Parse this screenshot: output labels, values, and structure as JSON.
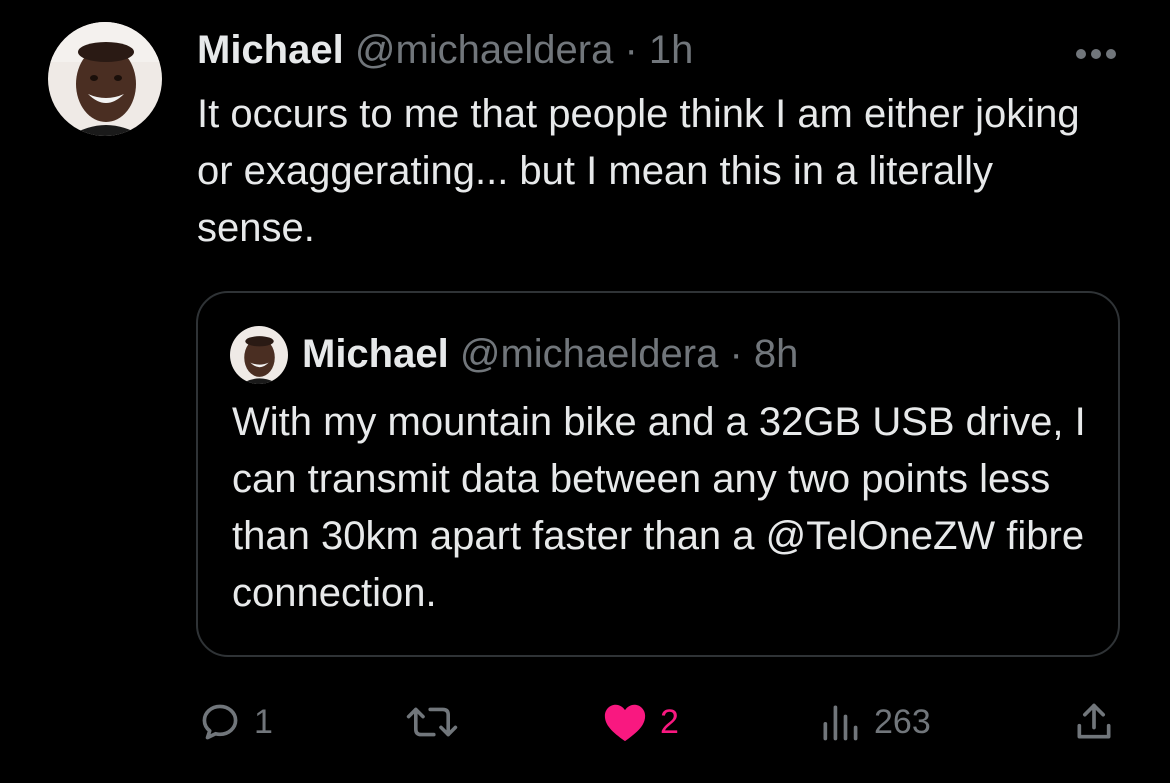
{
  "tweet": {
    "name": "Michael",
    "handle": "@michaeldera",
    "separator": "·",
    "time": "1h",
    "more_icon": "more-horizontal-icon",
    "text": "It occurs to me that people think I am either joking or exaggerating... but I mean this in a literally sense."
  },
  "quoted": {
    "name": "Michael",
    "handle": "@michaeldera",
    "separator": "·",
    "time": "8h",
    "text": "With my mountain bike and a 32GB USB drive, I can transmit data between any two points less than 30km apart faster than a @TelOneZW fibre connection."
  },
  "actions": {
    "reply": {
      "icon": "reply-icon",
      "count": "1"
    },
    "retweet": {
      "icon": "retweet-icon",
      "count": ""
    },
    "like": {
      "icon": "heart-icon",
      "count": "2",
      "liked": true
    },
    "views": {
      "icon": "views-icon",
      "count": "263"
    },
    "share": {
      "icon": "share-icon"
    }
  },
  "colors": {
    "background": "#000000",
    "text": "#e7e9ea",
    "muted": "#71767b",
    "like": "#f91880",
    "border": "#2f3336"
  }
}
